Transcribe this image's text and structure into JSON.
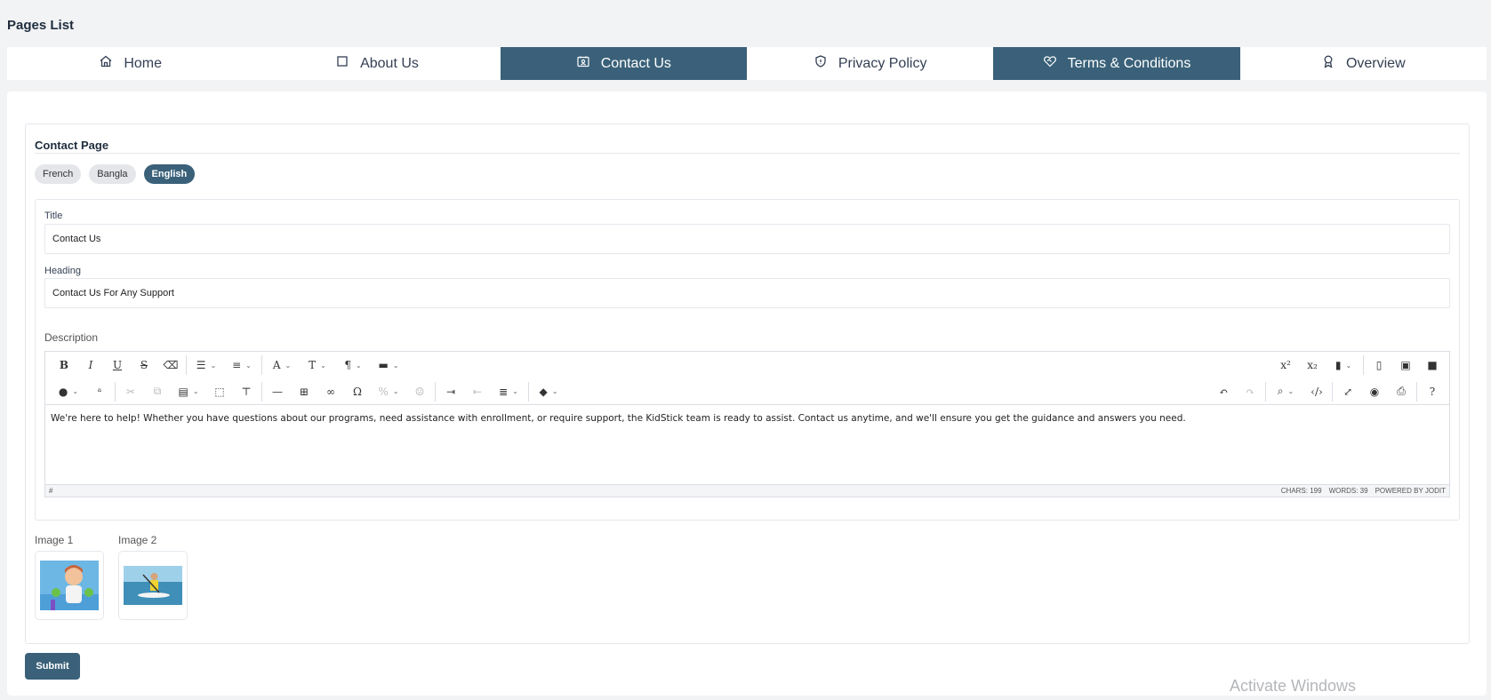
{
  "page_title": "Pages List",
  "tabs": [
    {
      "label": "Home",
      "icon": "home-icon",
      "active": false
    },
    {
      "label": "About Us",
      "icon": "square-icon",
      "active": false
    },
    {
      "label": "Contact Us",
      "icon": "contact-card-icon",
      "active": true
    },
    {
      "label": "Privacy Policy",
      "icon": "shield-icon",
      "active": false
    },
    {
      "label": "Terms & Conditions",
      "icon": "heart-handshake-icon",
      "active": true
    },
    {
      "label": "Overview",
      "icon": "award-icon",
      "active": false
    }
  ],
  "section_title": "Contact Page",
  "languages": [
    {
      "label": "French",
      "active": false
    },
    {
      "label": "Bangla",
      "active": false
    },
    {
      "label": "English",
      "active": true
    }
  ],
  "form": {
    "title_label": "Title",
    "title_value": "Contact Us",
    "heading_label": "Heading",
    "heading_value": "Contact Us For Any Support",
    "description_label": "Description",
    "description_text": "We're here to help! Whether you have questions about our programs, need assistance with enrollment, or require support, the KidStick team is ready to assist. Contact us anytime, and we'll ensure you get the guidance and answers you need."
  },
  "editor": {
    "status_chars": "CHARS: 199",
    "status_words": "WORDS: 39",
    "status_powered": "POWERED BY JODIT",
    "status_hash": "#"
  },
  "images": {
    "image1_label": "Image 1",
    "image2_label": "Image 2"
  },
  "submit_label": "Submit",
  "watermark": "Activate Windows",
  "colors": {
    "accent": "#3a6179",
    "background": "#f2f3f5"
  }
}
